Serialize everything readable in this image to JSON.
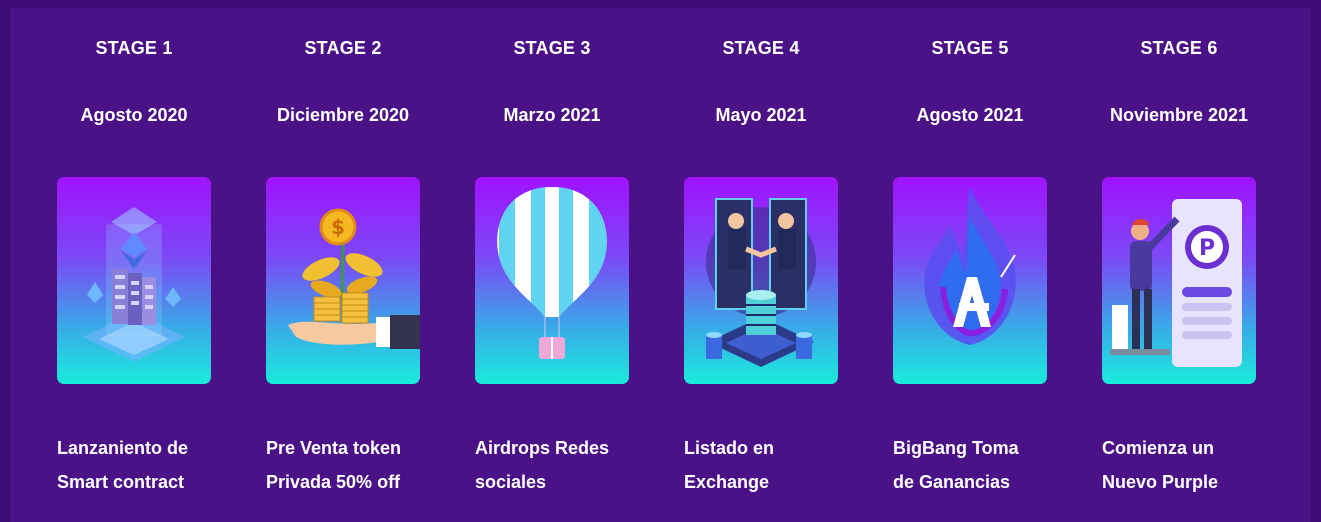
{
  "stages": [
    {
      "title": "STAGE 1",
      "date": "Agosto 2020",
      "line1": "Lanzaniento de",
      "line2": "Smart contract",
      "icon": "smart-contract-icon"
    },
    {
      "title": "STAGE 2",
      "date": "Diciembre 2020",
      "line1": "Pre Venta token",
      "line2": "Privada 50% off",
      "icon": "money-plant-icon"
    },
    {
      "title": "STAGE 3",
      "date": "Marzo 2021",
      "line1": "Airdrops Redes",
      "line2": "sociales",
      "icon": "hot-air-balloon-icon"
    },
    {
      "title": "STAGE 4",
      "date": "Mayo 2021",
      "line1": "Listado en",
      "line2": "Exchange",
      "icon": "handshake-exchange-icon"
    },
    {
      "title": "STAGE 5",
      "date": "Agosto 2021",
      "line1": "BigBang Toma",
      "line2": "de Ganancias",
      "icon": "flame-logo-icon"
    },
    {
      "title": "STAGE 6",
      "date": "Noviembre 2021",
      "line1": "Comienza un",
      "line2": "Nuevo Purple",
      "icon": "purple-app-icon"
    }
  ],
  "colors": {
    "background": "#4b1287",
    "card_top": "#a012ff",
    "card_bottom": "#19ecdc",
    "text": "#ffffff"
  }
}
